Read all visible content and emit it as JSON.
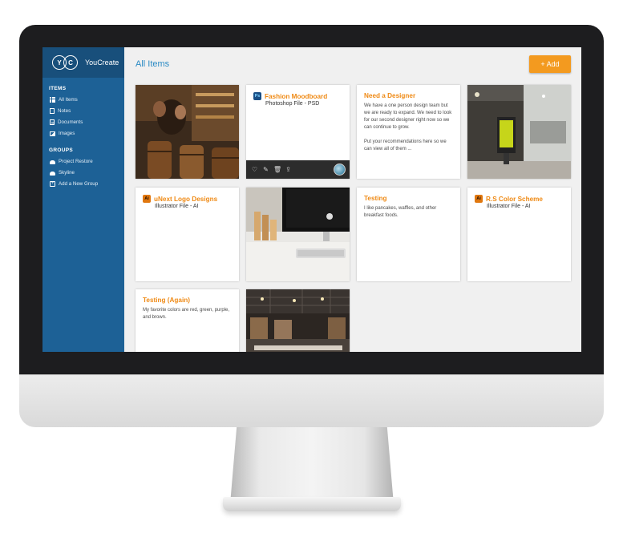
{
  "brand": {
    "logo_letters": [
      "Y",
      "C"
    ],
    "name": "YouCreate"
  },
  "sidebar": {
    "items_title": "ITEMS",
    "items": [
      {
        "label": "All Items",
        "icon": "grid-icon"
      },
      {
        "label": "Notes",
        "icon": "note-icon"
      },
      {
        "label": "Documents",
        "icon": "document-icon"
      },
      {
        "label": "Images",
        "icon": "image-icon"
      }
    ],
    "groups_title": "GROUPS",
    "groups": [
      {
        "label": "Project Restore",
        "icon": "car-icon"
      },
      {
        "label": "Skyline",
        "icon": "car-icon"
      },
      {
        "label": "Add a New Group",
        "icon": "plus-square-icon"
      }
    ]
  },
  "header": {
    "title": "All Items",
    "add_label": "+ Add"
  },
  "cards": {
    "fashion": {
      "badge": "Ps",
      "title": "Fashion Moodboard",
      "subtitle": "Photoshop File - PSD"
    },
    "designer": {
      "title": "Need a Designer",
      "text": "We have a one person design team but we are ready to expand. We need to look for our second designer right now so we can continue to grow.\n\nPut your recommendations here so we can view all of them ..."
    },
    "unext": {
      "badge": "Ai",
      "title": "uNext Logo Designs",
      "subtitle": "Illustrator File - AI"
    },
    "testing": {
      "title": "Testing",
      "text": "I like pancakes, waffles, and other breakfast foods."
    },
    "rs": {
      "badge": "Ai",
      "title": "R.S Color Scheme",
      "subtitle": "Illustrator File - AI"
    },
    "testing_again": {
      "title": "Testing (Again)",
      "text": "My favorite colors are red, green, purple, and brown."
    }
  },
  "toolbar_icons": [
    "heart-icon",
    "edit-icon",
    "trash-icon",
    "share-icon"
  ],
  "colors": {
    "accent": "#f39a1f",
    "sidebar": "#1d6196",
    "title": "#2a8ac4"
  }
}
